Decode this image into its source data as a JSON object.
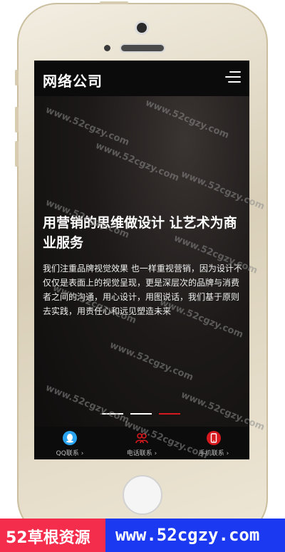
{
  "header": {
    "logo": "网络公司"
  },
  "hero": {
    "title": "用营销的思维做设计 让艺术为商业服务",
    "description": "我们注重品牌视觉效果 也一样重视营销，因为设计不仅仅是表面上的视觉呈现，更是深层次的品牌与消费者之间的沟通，用心设计，用图说话，我们基于原则去实践，用责任心和远见塑造未来"
  },
  "slider": {
    "slide_count": 3,
    "active_index": 2
  },
  "bottom_nav": [
    {
      "label": "QQ联系 ›",
      "icon": "qq-icon",
      "color": "#2aa4f0"
    },
    {
      "label": "电话联系 ›",
      "icon": "phone-contact-icon",
      "color": "#d6191f"
    },
    {
      "label": "手机联系 ›",
      "icon": "mobile-icon",
      "color": "#d6191f"
    }
  ],
  "watermark": "www.52cgzy.com",
  "footer_banner": {
    "left_text": "52草根资源",
    "right_text": "www.52cgzy.com"
  },
  "colors": {
    "accent": "#d6191f",
    "banner_left": "#f52d4c",
    "banner_right": "#1b39f0"
  }
}
